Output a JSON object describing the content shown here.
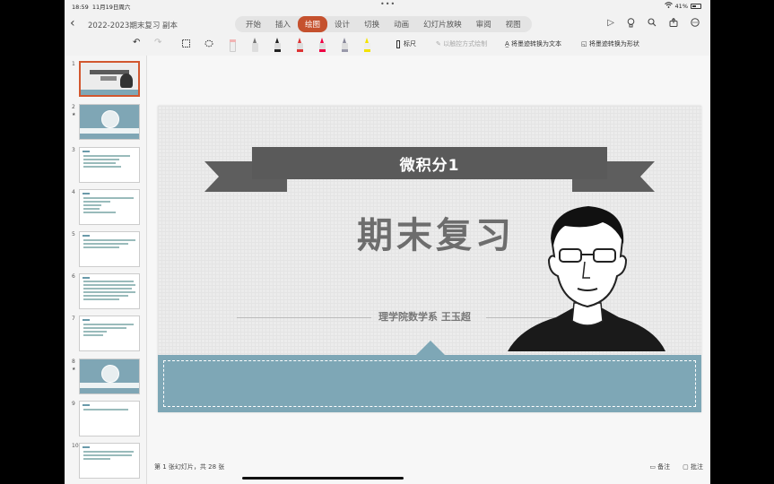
{
  "status": {
    "time": "18:59",
    "date": "11月19日周六",
    "battery": "41%"
  },
  "nav": {
    "doc_title": "2022-2023期末复习 副本",
    "tabs": [
      "开始",
      "插入",
      "绘图",
      "设计",
      "切换",
      "动画",
      "幻灯片放映",
      "审阅",
      "视图"
    ],
    "active_tab": "绘图"
  },
  "toolbar": {
    "ruler": "标尺",
    "touch_draw": "以触控方式绘制",
    "ink_to_text": "将墨迹转换为文本",
    "ink_to_shape": "将墨迹转换为形状"
  },
  "thumbnails": [
    {
      "num": "1",
      "star": ""
    },
    {
      "num": "2",
      "star": "★"
    },
    {
      "num": "3",
      "star": ""
    },
    {
      "num": "4",
      "star": ""
    },
    {
      "num": "5",
      "star": ""
    },
    {
      "num": "6",
      "star": ""
    },
    {
      "num": "7",
      "star": ""
    },
    {
      "num": "8",
      "star": "★"
    },
    {
      "num": "9",
      "star": ""
    },
    {
      "num": "10",
      "star": ""
    }
  ],
  "slide": {
    "ribbon_text": "微积分1",
    "title": "期末复习",
    "author": "理学院数学系 王玉超"
  },
  "bottom": {
    "slide_count": "第 1 张幻灯片，共 28 张",
    "notes": "备注",
    "comments": "批注"
  },
  "colors": {
    "accent": "#c5512e",
    "teal": "#7ea7b6",
    "ribbon": "#5a5a5a"
  }
}
